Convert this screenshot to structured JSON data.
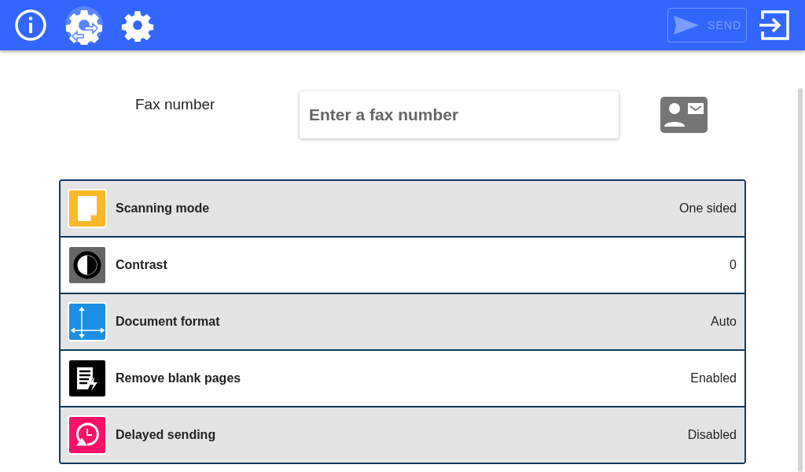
{
  "toolbar": {
    "send_button": {
      "label": "SEND",
      "disabled": true
    }
  },
  "fax": {
    "label": "Fax number",
    "placeholder": "Enter a fax number"
  },
  "settings": [
    {
      "kind": "page",
      "color": "#fbb829",
      "label": "Scanning mode",
      "value": "One sided"
    },
    {
      "kind": "contrast",
      "color": "#666666",
      "label": "Contrast",
      "value": "0"
    },
    {
      "kind": "format",
      "color": "#1a8fe3",
      "label": "Document format",
      "value": "Auto"
    },
    {
      "kind": "blank",
      "color": "#000000",
      "label": "Remove blank pages",
      "value": "Enabled"
    },
    {
      "kind": "delay",
      "color": "#ff1066",
      "label": "Delayed sending",
      "value": "Disabled"
    }
  ]
}
